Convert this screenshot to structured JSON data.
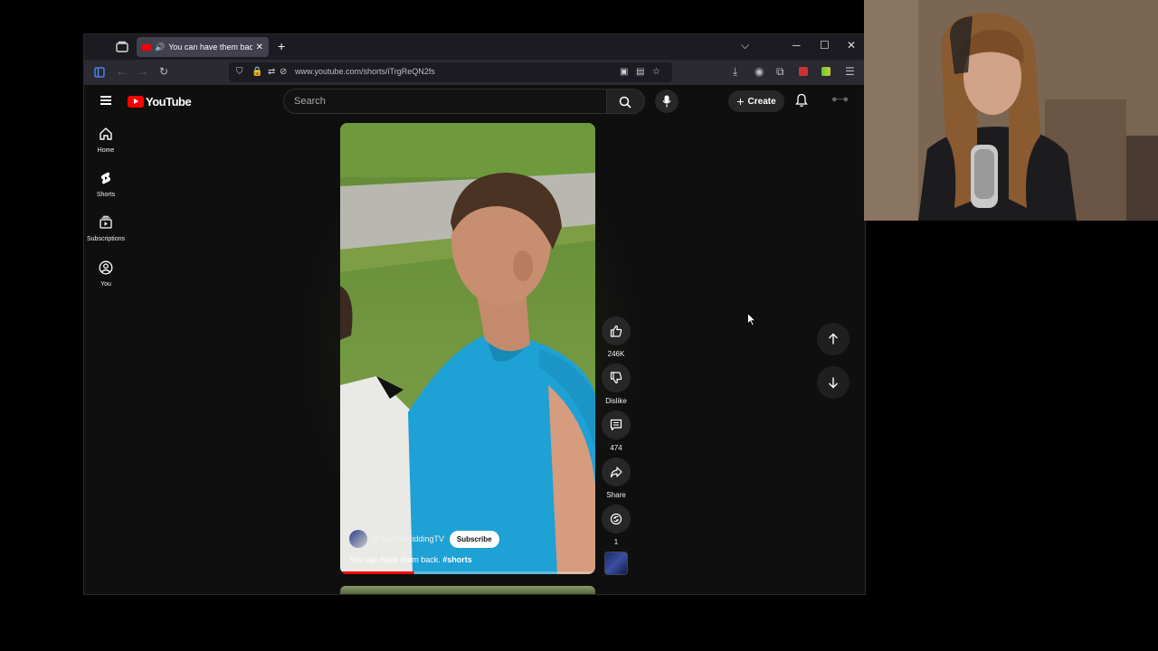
{
  "browser": {
    "tab_title": "You can have them back. #s",
    "url": "www.youtube.com/shorts/iTrgReQN2fs"
  },
  "youtube": {
    "logo_text": "YouTube",
    "search_placeholder": "Search",
    "create_label": "Create",
    "sidebar": [
      {
        "label": "Home"
      },
      {
        "label": "Shorts"
      },
      {
        "label": "Subscriptions"
      },
      {
        "label": "You"
      }
    ],
    "short": {
      "channel": "@AreYouKiddingTV",
      "subscribe_label": "Subscribe",
      "caption": "You can have them back.",
      "hashtag": "#shorts",
      "progress": 0.29
    },
    "actions": {
      "likes": "246K",
      "dislike_label": "Dislike",
      "comments": "474",
      "share_label": "Share",
      "remix_count": "1"
    }
  },
  "colors": {
    "accent": "#ff0000",
    "background": "#0f0f0f",
    "shirt": "#1b9fd0"
  }
}
